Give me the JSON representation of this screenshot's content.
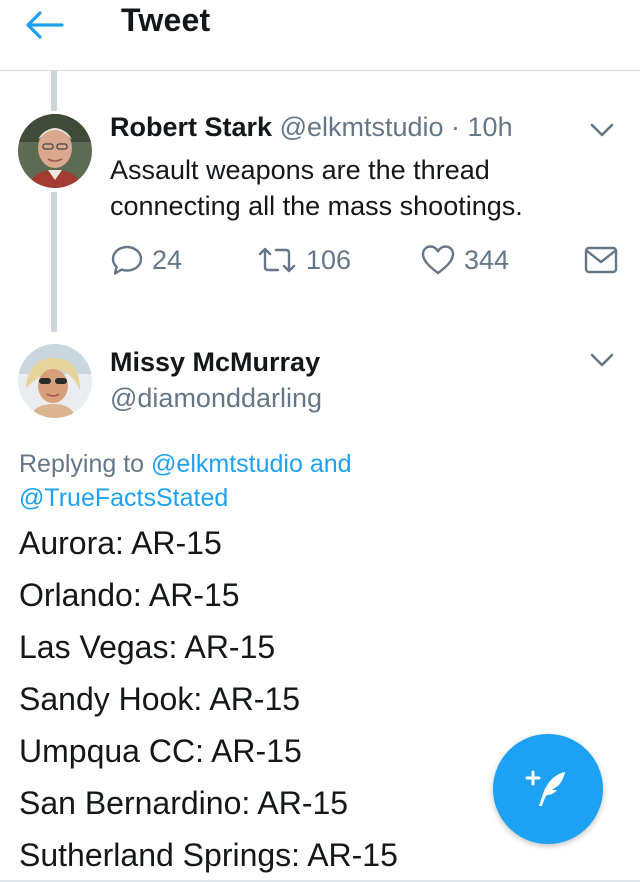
{
  "header": {
    "title": "Tweet"
  },
  "parent_tweet": {
    "author_name": "Robert Stark",
    "author_handle": "@elkmtstudio",
    "time": "· 10h",
    "text": "Assault weapons are the thread connecting all the mass shootings.",
    "actions": {
      "replies": "24",
      "retweets": "106",
      "likes": "344"
    }
  },
  "reply_tweet": {
    "author_name": "Missy McMurray",
    "author_handle": "@diamonddarling",
    "replying_prefix": "Replying to",
    "replying_to_1": "@elkmtstudio",
    "replying_and": "and",
    "replying_to_2": "@TrueFactsStated",
    "lines": [
      "Aurora: AR-15",
      "Orlando: AR-15",
      "Las Vegas: AR-15",
      "Sandy Hook: AR-15",
      "Umpqua CC: AR-15",
      "San Bernardino: AR-15",
      "Sutherland Springs: AR-15"
    ]
  },
  "colors": {
    "accent": "#1da1f2",
    "muted": "#657786",
    "thread_line": "#ccd6dd"
  },
  "icons": {
    "back": "arrow-left-icon",
    "more": "chevron-down-icon",
    "reply": "reply-icon",
    "retweet": "retweet-icon",
    "like": "heart-icon",
    "message": "envelope-icon",
    "compose": "compose-quill-icon"
  }
}
